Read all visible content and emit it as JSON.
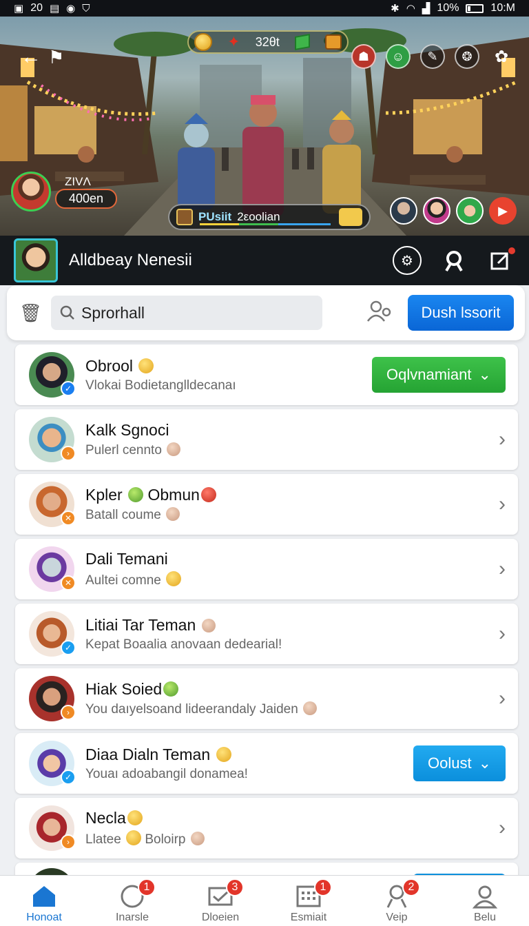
{
  "status_bar": {
    "left_time": "20",
    "battery_percent": "10%",
    "clock": "10:M"
  },
  "banner": {
    "hud_value": "32θt",
    "player": {
      "name": "ZIVΛ",
      "score": "400en"
    },
    "quest": {
      "name": "PUsiit",
      "value": "2εoolian"
    }
  },
  "profile": {
    "name": "Alldbeay Nenesii"
  },
  "search": {
    "value": "Sprorhall",
    "button_label": "Dush Ɩssorit"
  },
  "friends": [
    {
      "name": "Obrool",
      "sub": "Vlokai Bodietanglldecanaı",
      "action": "Oqlvnamiant",
      "action_style": "green",
      "status": "online-blue"
    },
    {
      "name": "Kalk Sgnoci",
      "sub": "Pulerl cennto",
      "status": "orange"
    },
    {
      "name": "Kpler",
      "name2": "Obmun",
      "sub": "Batall coume",
      "status": "orange"
    },
    {
      "name": "Dali Temani",
      "sub": "Aultei comne",
      "status": "orange"
    },
    {
      "name": "Litiai Tar Teman",
      "sub": "Kepat Boaalia anovaan dedearial!",
      "status": "blue"
    },
    {
      "name": "Hiak Soied",
      "sub": "You daıyelsoand lideerandaly Jaiden",
      "status": "orange"
    },
    {
      "name": "Diaa Dialn Teman",
      "sub": "Youaı adoabangil donamea!",
      "action": "Oolust",
      "action_style": "cyan",
      "status": "blue"
    },
    {
      "name": "Necla",
      "sub": "Llatee",
      "sub2": "Boloirp",
      "status": "orange"
    }
  ],
  "bottom_nav": [
    {
      "label": "Honoat",
      "icon": "home-icon",
      "badge": ""
    },
    {
      "label": "Inarsle",
      "icon": "chat-icon",
      "badge": "1"
    },
    {
      "label": "Dloeien",
      "icon": "inbox-icon",
      "badge": "3"
    },
    {
      "label": "Esmiait",
      "icon": "calendar-icon",
      "badge": "1"
    },
    {
      "label": "Veip",
      "icon": "friends-icon",
      "badge": "2"
    },
    {
      "label": "Belu",
      "icon": "profile-icon",
      "badge": ""
    }
  ],
  "colors": {
    "primary": "#0a66d6",
    "accept_green": "#25a333",
    "cyan_button": "#0b8fdc",
    "badge_red": "#e2352a",
    "active_nav": "#1a76d2"
  }
}
